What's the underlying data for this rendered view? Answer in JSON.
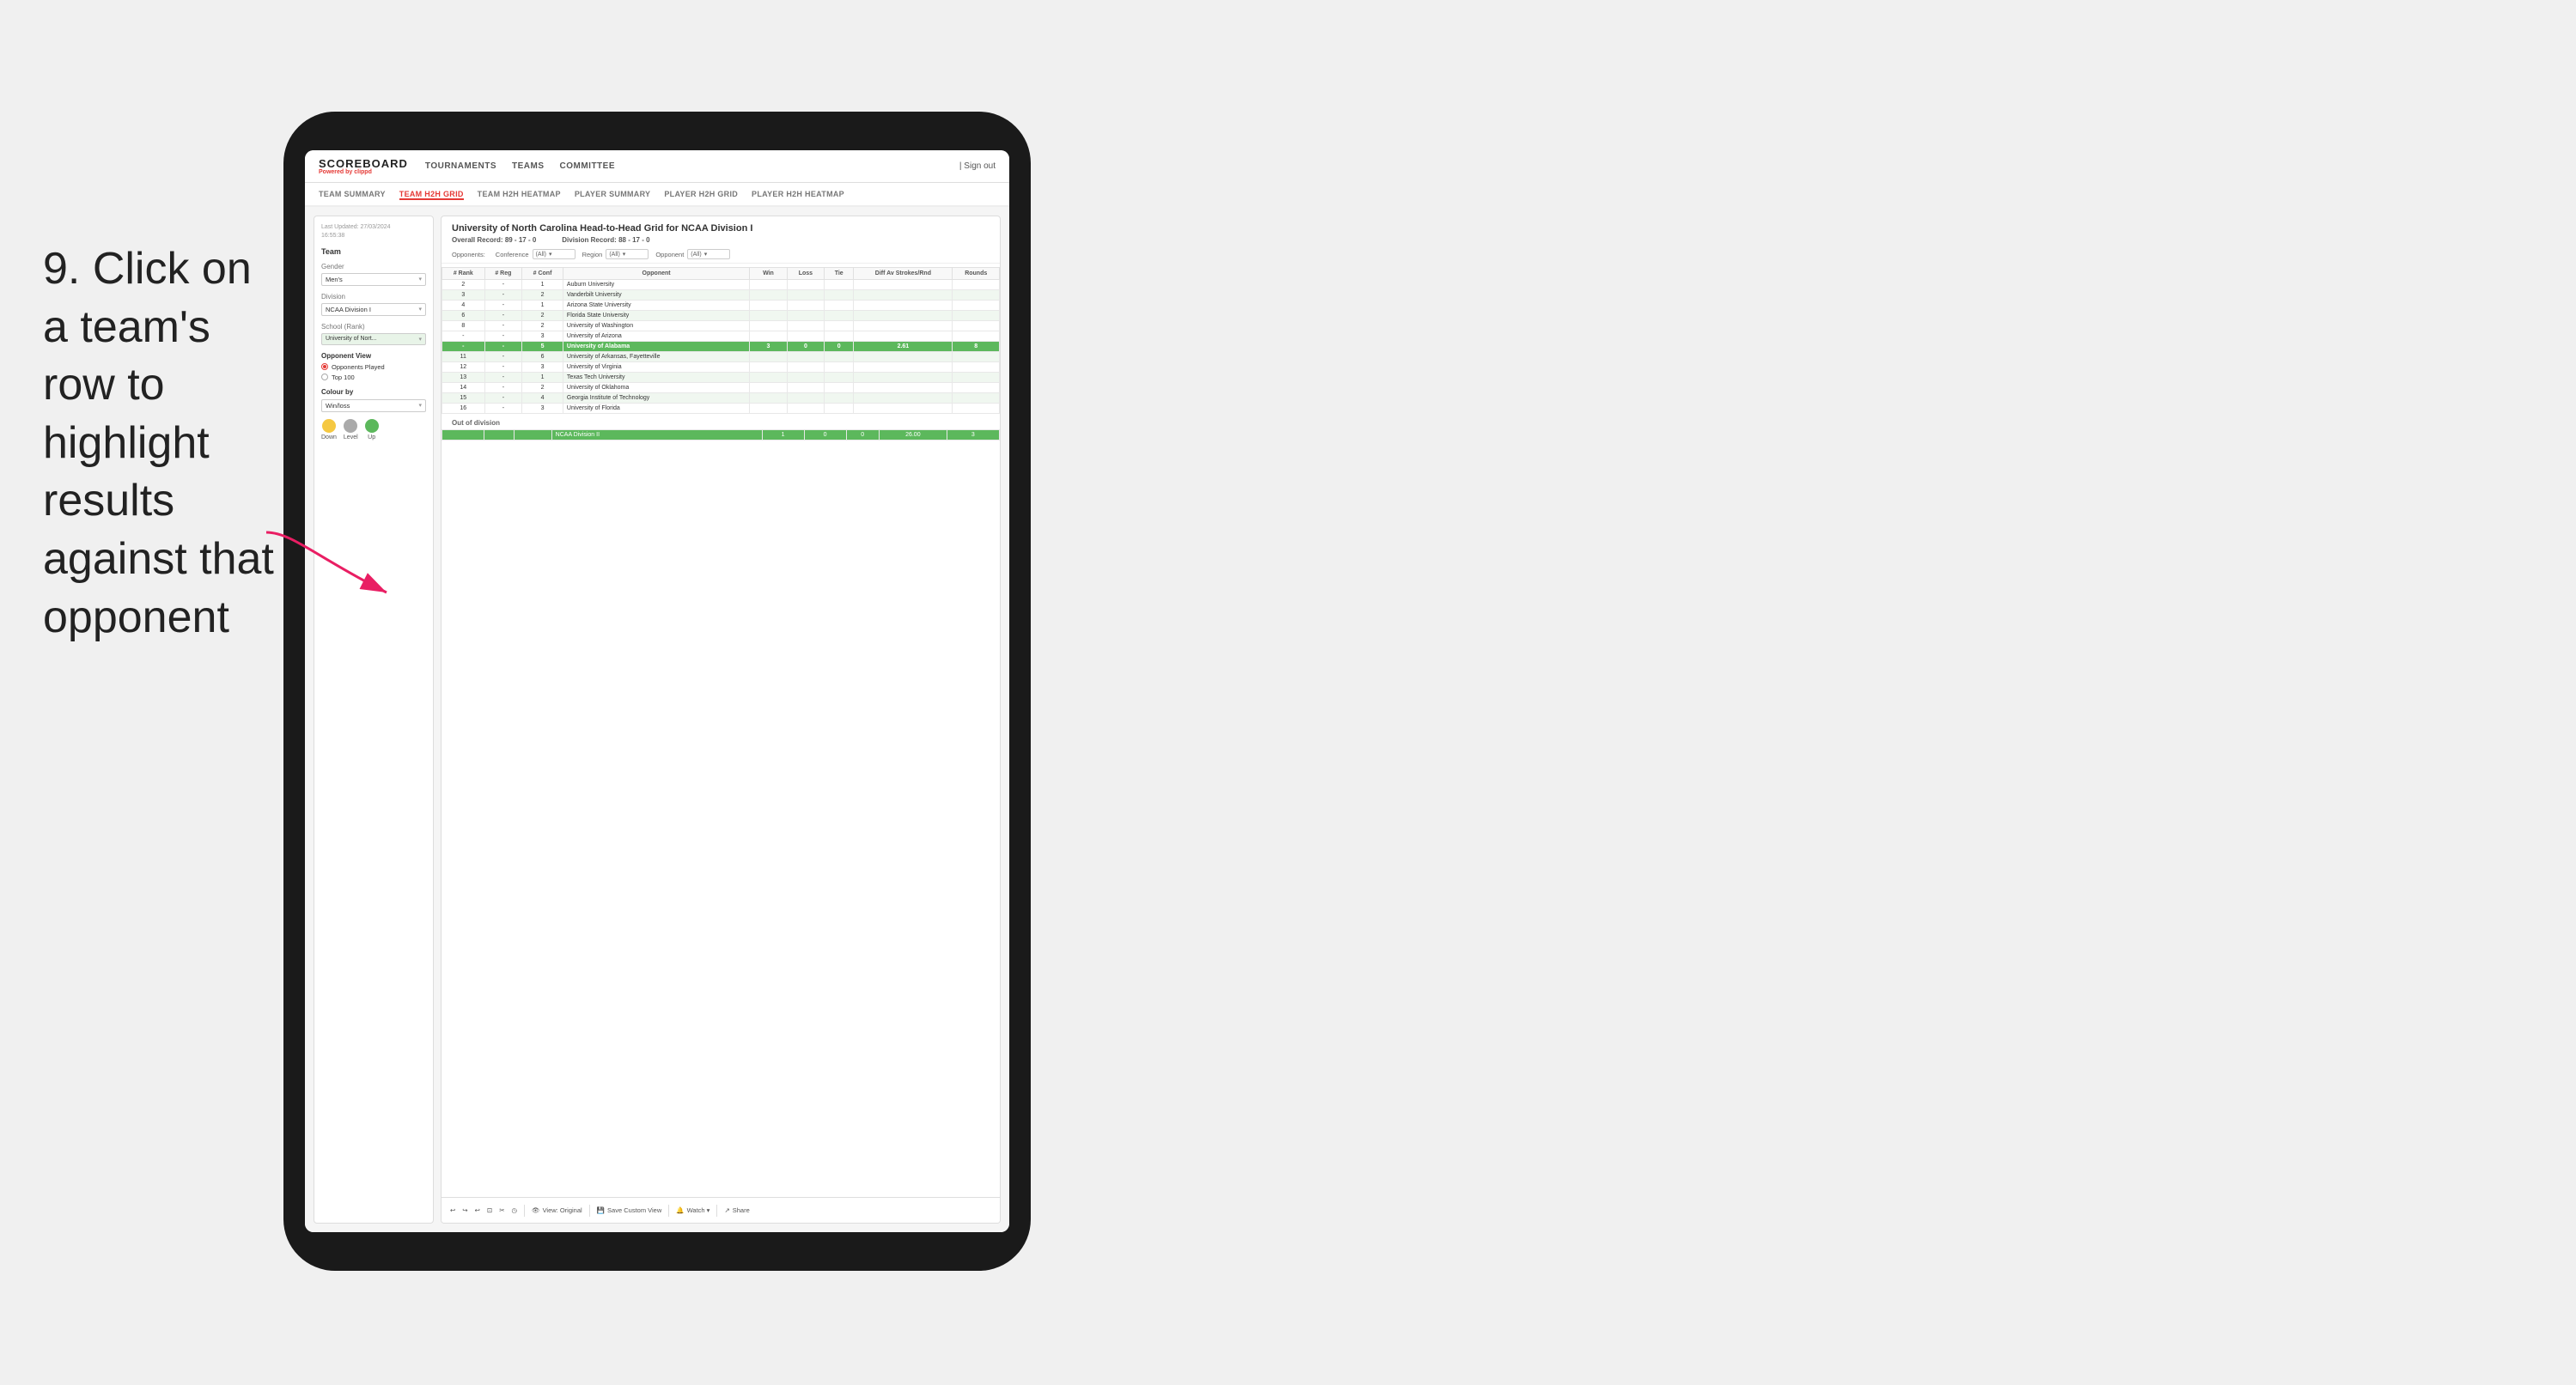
{
  "instruction": {
    "text": "9. Click on a team's row to highlight results against that opponent"
  },
  "navbar": {
    "logo": {
      "scoreboard": "SCOREBOARD",
      "powered": "Powered by",
      "brand": "clippd"
    },
    "links": [
      "TOURNAMENTS",
      "TEAMS",
      "COMMITTEE"
    ],
    "sign_out": "Sign out"
  },
  "subnav": {
    "items": [
      "TEAM SUMMARY",
      "TEAM H2H GRID",
      "TEAM H2H HEATMAP",
      "PLAYER SUMMARY",
      "PLAYER H2H GRID",
      "PLAYER H2H HEATMAP"
    ],
    "active": "TEAM H2H GRID"
  },
  "left_panel": {
    "last_updated_label": "Last Updated: 27/03/2024",
    "last_updated_time": "16:55:38",
    "team_label": "Team",
    "gender_label": "Gender",
    "gender_value": "Men's",
    "division_label": "Division",
    "division_value": "NCAA Division I",
    "school_label": "School (Rank)",
    "school_value": "University of Nort...",
    "opponent_view_label": "Opponent View",
    "radio_options": [
      "Opponents Played",
      "Top 100"
    ],
    "radio_selected": "Opponents Played",
    "colour_by_label": "Colour by",
    "colour_value": "Win/loss",
    "legend": [
      {
        "label": "Down",
        "color": "#f5c842"
      },
      {
        "label": "Level",
        "color": "#aaaaaa"
      },
      {
        "label": "Up",
        "color": "#5cb85c"
      }
    ]
  },
  "grid": {
    "title": "University of North Carolina Head-to-Head Grid for NCAA Division I",
    "overall_record_label": "Overall Record:",
    "overall_record": "89 - 17 - 0",
    "division_record_label": "Division Record:",
    "division_record": "88 - 17 - 0",
    "filters": {
      "opponents_label": "Opponents:",
      "conference_label": "Conference",
      "conference_value": "(All)",
      "region_label": "Region",
      "region_value": "(All)",
      "opponent_label": "Opponent",
      "opponent_value": "(All)"
    },
    "columns": [
      "# Rank",
      "# Reg",
      "# Conf",
      "Opponent",
      "Win",
      "Loss",
      "Tie",
      "Diff Av Strokes/Rnd",
      "Rounds"
    ],
    "rows": [
      {
        "rank": "2",
        "reg": "-",
        "conf": "1",
        "opponent": "Auburn University",
        "win": "",
        "loss": "",
        "tie": "",
        "diff": "",
        "rounds": "",
        "style": "normal"
      },
      {
        "rank": "3",
        "reg": "-",
        "conf": "2",
        "opponent": "Vanderbilt University",
        "win": "",
        "loss": "",
        "tie": "",
        "diff": "",
        "rounds": "",
        "style": "light-green"
      },
      {
        "rank": "4",
        "reg": "-",
        "conf": "1",
        "opponent": "Arizona State University",
        "win": "",
        "loss": "",
        "tie": "",
        "diff": "",
        "rounds": "",
        "style": "normal"
      },
      {
        "rank": "6",
        "reg": "-",
        "conf": "2",
        "opponent": "Florida State University",
        "win": "",
        "loss": "",
        "tie": "",
        "diff": "",
        "rounds": "",
        "style": "light-green"
      },
      {
        "rank": "8",
        "reg": "-",
        "conf": "2",
        "opponent": "University of Washington",
        "win": "",
        "loss": "",
        "tie": "",
        "diff": "",
        "rounds": "",
        "style": "normal"
      },
      {
        "rank": "-",
        "reg": "-",
        "conf": "3",
        "opponent": "University of Arizona",
        "win": "",
        "loss": "",
        "tie": "",
        "diff": "",
        "rounds": "",
        "style": "normal"
      },
      {
        "rank": "-",
        "reg": "-",
        "conf": "5",
        "opponent": "University of Alabama",
        "win": "3",
        "loss": "0",
        "tie": "0",
        "diff": "2.61",
        "rounds": "8",
        "style": "highlighted"
      },
      {
        "rank": "11",
        "reg": "-",
        "conf": "6",
        "opponent": "University of Arkansas, Fayetteville",
        "win": "",
        "loss": "",
        "tie": "",
        "diff": "",
        "rounds": "",
        "style": "light-green"
      },
      {
        "rank": "12",
        "reg": "-",
        "conf": "3",
        "opponent": "University of Virginia",
        "win": "",
        "loss": "",
        "tie": "",
        "diff": "",
        "rounds": "",
        "style": "normal"
      },
      {
        "rank": "13",
        "reg": "-",
        "conf": "1",
        "opponent": "Texas Tech University",
        "win": "",
        "loss": "",
        "tie": "",
        "diff": "",
        "rounds": "",
        "style": "light-green"
      },
      {
        "rank": "14",
        "reg": "-",
        "conf": "2",
        "opponent": "University of Oklahoma",
        "win": "",
        "loss": "",
        "tie": "",
        "diff": "",
        "rounds": "",
        "style": "normal"
      },
      {
        "rank": "15",
        "reg": "-",
        "conf": "4",
        "opponent": "Georgia Institute of Technology",
        "win": "",
        "loss": "",
        "tie": "",
        "diff": "",
        "rounds": "",
        "style": "light-green"
      },
      {
        "rank": "16",
        "reg": "-",
        "conf": "3",
        "opponent": "University of Florida",
        "win": "",
        "loss": "",
        "tie": "",
        "diff": "",
        "rounds": "",
        "style": "normal"
      }
    ],
    "out_of_division_label": "Out of division",
    "out_of_division_row": {
      "label": "NCAA Division II",
      "win": "1",
      "loss": "0",
      "tie": "0",
      "diff": "26.00",
      "rounds": "3"
    }
  },
  "toolbar": {
    "undo": "↩",
    "redo": "↪",
    "view_original": "View: Original",
    "save_custom": "Save Custom View",
    "watch": "Watch ▾",
    "share": "Share"
  }
}
